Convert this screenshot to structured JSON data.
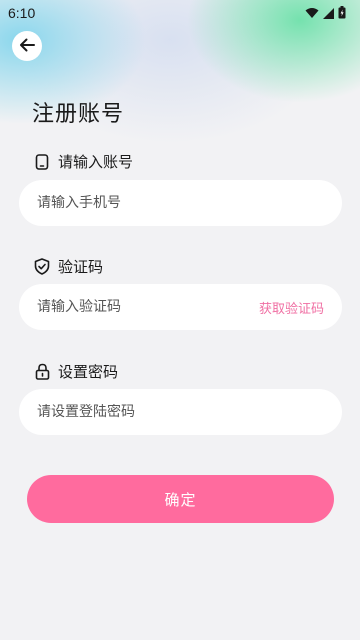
{
  "status_bar": {
    "time": "6:10",
    "icons": [
      "wifi-icon",
      "signal-icon",
      "battery-icon"
    ]
  },
  "header": {
    "back_icon": "arrow-left-icon",
    "title": "注册账号"
  },
  "form": {
    "account": {
      "icon": "phone-icon",
      "label": "请输入账号",
      "placeholder": "请输入手机号",
      "value": ""
    },
    "code": {
      "icon": "shield-check-icon",
      "label": "验证码",
      "placeholder": "请输入验证码",
      "value": "",
      "get_code_label": "获取验证码"
    },
    "password": {
      "icon": "lock-icon",
      "label": "设置密码",
      "placeholder": "请设置登陆密码",
      "value": ""
    }
  },
  "confirm_label": "确定",
  "colors": {
    "accent": "#ff6b9e",
    "link": "#f06fa3",
    "background": "#f2f2f4"
  }
}
